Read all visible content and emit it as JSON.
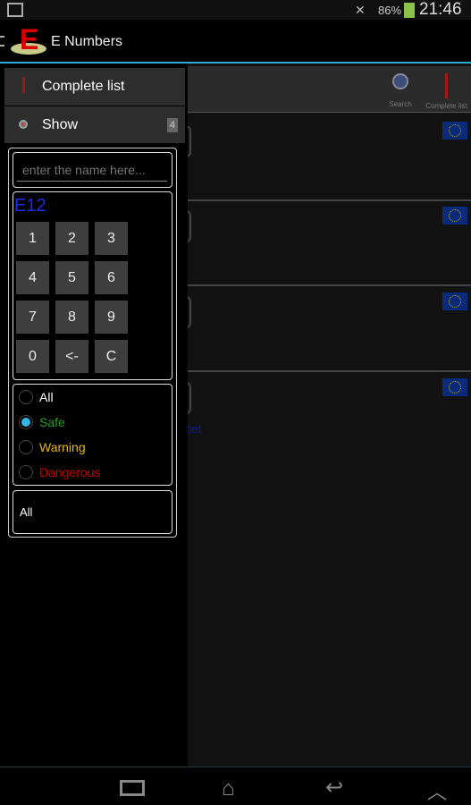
{
  "status": {
    "battery": "86%",
    "time": "21:46",
    "battery_color": "#8bc34a",
    "icons": [
      "image-icon",
      "mute-icon",
      "battery-icon"
    ]
  },
  "app": {
    "title": "E Numbers",
    "logo_letter": "E"
  },
  "toolbar": {
    "search_label": "Search",
    "complete_label": "Complete list"
  },
  "drawer": {
    "menu": [
      {
        "label": "Complete list",
        "icon": "exclamation-icon"
      },
      {
        "label": "Show",
        "icon": "magnifier-icon",
        "badge": "4"
      }
    ],
    "search_placeholder": "enter the name here...",
    "code": "E12",
    "keys": [
      "1",
      "2",
      "3",
      "4",
      "5",
      "6",
      "7",
      "8",
      "9",
      "0",
      "<-",
      "C"
    ],
    "filters": [
      {
        "label": "All",
        "color": "#ffffff",
        "checked": false
      },
      {
        "label": "Safe",
        "color": "#1fa01f",
        "checked": true
      },
      {
        "label": "Warning",
        "color": "#e6b800",
        "checked": false
      },
      {
        "label": "Dangerous",
        "color": "#cc0000",
        "checked": false
      }
    ],
    "category": "All"
  },
  "list": {
    "partial_text": "set"
  }
}
